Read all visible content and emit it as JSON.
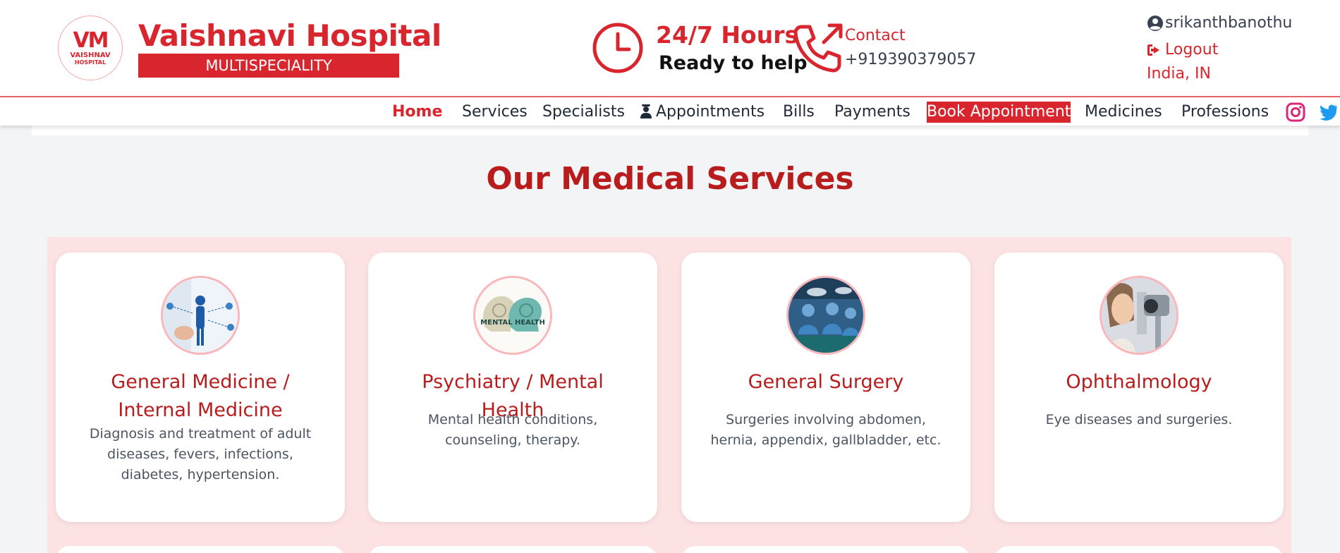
{
  "header": {
    "logo": {
      "text": "VM",
      "sub1": "VAISHNAV",
      "sub2": "HOSPITAL"
    },
    "brand_title": "Vaishnavi Hospital",
    "brand_subtitle": "MULTISPECIALITY",
    "hours_title": "24/7 Hours",
    "hours_subtitle": "Ready to help",
    "contact_label": "Contact",
    "contact_phone": "+919390379057",
    "username": "srikanthbanothu",
    "logout_label": "Logout",
    "locale": "India, IN"
  },
  "nav": {
    "items": [
      {
        "label": "Home",
        "active": true
      },
      {
        "label": "Services"
      },
      {
        "label": "Specialists"
      },
      {
        "label": "Appointments",
        "icon": "user-nurse-icon"
      },
      {
        "label": "Bills"
      },
      {
        "label": "Payments"
      },
      {
        "label": "Book Appointment",
        "highlight": true
      },
      {
        "label": "Medicines"
      },
      {
        "label": "Professions"
      }
    ],
    "social": [
      "instagram-icon",
      "twitter-icon"
    ]
  },
  "main": {
    "section_title": "Our Medical Services",
    "cards": [
      {
        "title": "General Medicine / Internal Medicine",
        "description": "Diagnosis and treatment of adult diseases, fevers, infections, diabetes, hypertension.",
        "image": "doctor-anatomy-image"
      },
      {
        "title": "Psychiatry / Mental Health",
        "description": "Mental health conditions, counseling, therapy.",
        "image": "mental-health-image",
        "image_text": "MENTAL HEALTH"
      },
      {
        "title": "General Surgery",
        "description": "Surgeries involving abdomen, hernia, appendix, gallbladder, etc.",
        "image": "surgery-team-image"
      },
      {
        "title": "Ophthalmology",
        "description": "Eye diseases and surgeries.",
        "image": "eye-exam-image"
      }
    ]
  },
  "colors": {
    "brand_red": "#d9262e",
    "title_red": "#b91c1c",
    "panel_pink": "#fde2e3",
    "page_bg": "#f3f4f6"
  }
}
